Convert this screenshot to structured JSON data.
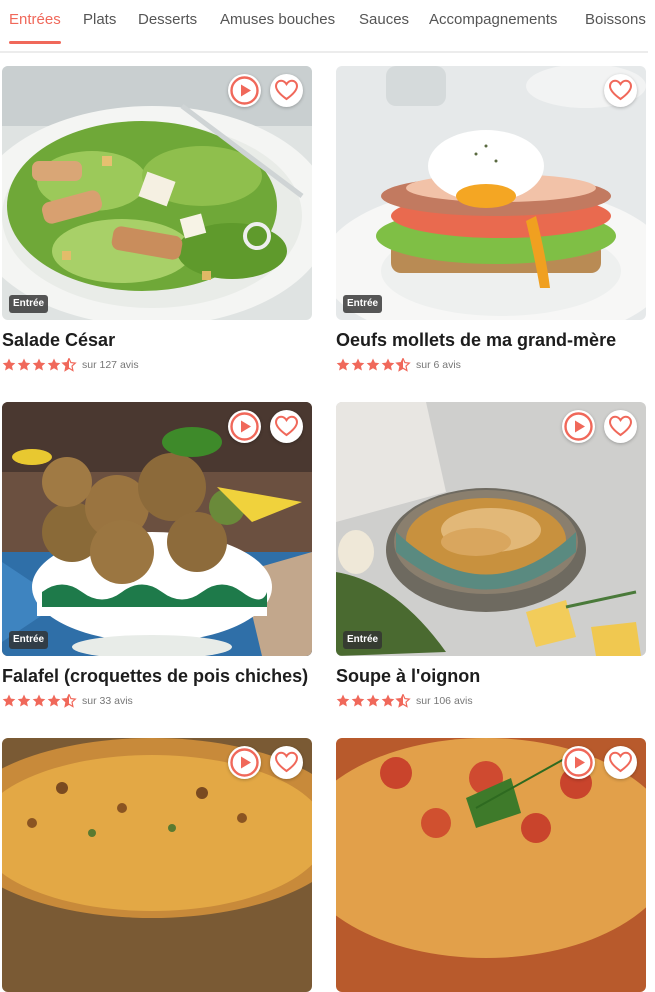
{
  "tabs": [
    {
      "label": "Entrées",
      "active": true
    },
    {
      "label": "Plats"
    },
    {
      "label": "Desserts"
    },
    {
      "label": "Amuses bouches"
    },
    {
      "label": "Sauces"
    },
    {
      "label": "Accompagnements"
    },
    {
      "label": "Boissons"
    }
  ],
  "accent_color": "#f0685a",
  "icons": {
    "play": "play-icon",
    "favorite": "heart-icon",
    "rating": "star-icon"
  },
  "recipes": [
    {
      "title": "Salade César",
      "badge": "Entrée",
      "rating": 4.5,
      "reviews": "sur 127 avis"
    },
    {
      "title": "Oeufs mollets de ma grand-mère",
      "badge": "Entrée",
      "rating": 4.5,
      "reviews": "sur 6 avis"
    },
    {
      "title": "Falafel (croquettes de pois chiches)",
      "badge": "Entrée",
      "rating": 4.5,
      "reviews": "sur 33 avis"
    },
    {
      "title": "Soupe à l'oignon",
      "badge": "Entrée",
      "rating": 4.5,
      "reviews": "sur 106 avis"
    },
    {
      "title": "",
      "badge": "",
      "rating": null,
      "reviews": ""
    },
    {
      "title": "",
      "badge": "",
      "rating": null,
      "reviews": ""
    }
  ]
}
